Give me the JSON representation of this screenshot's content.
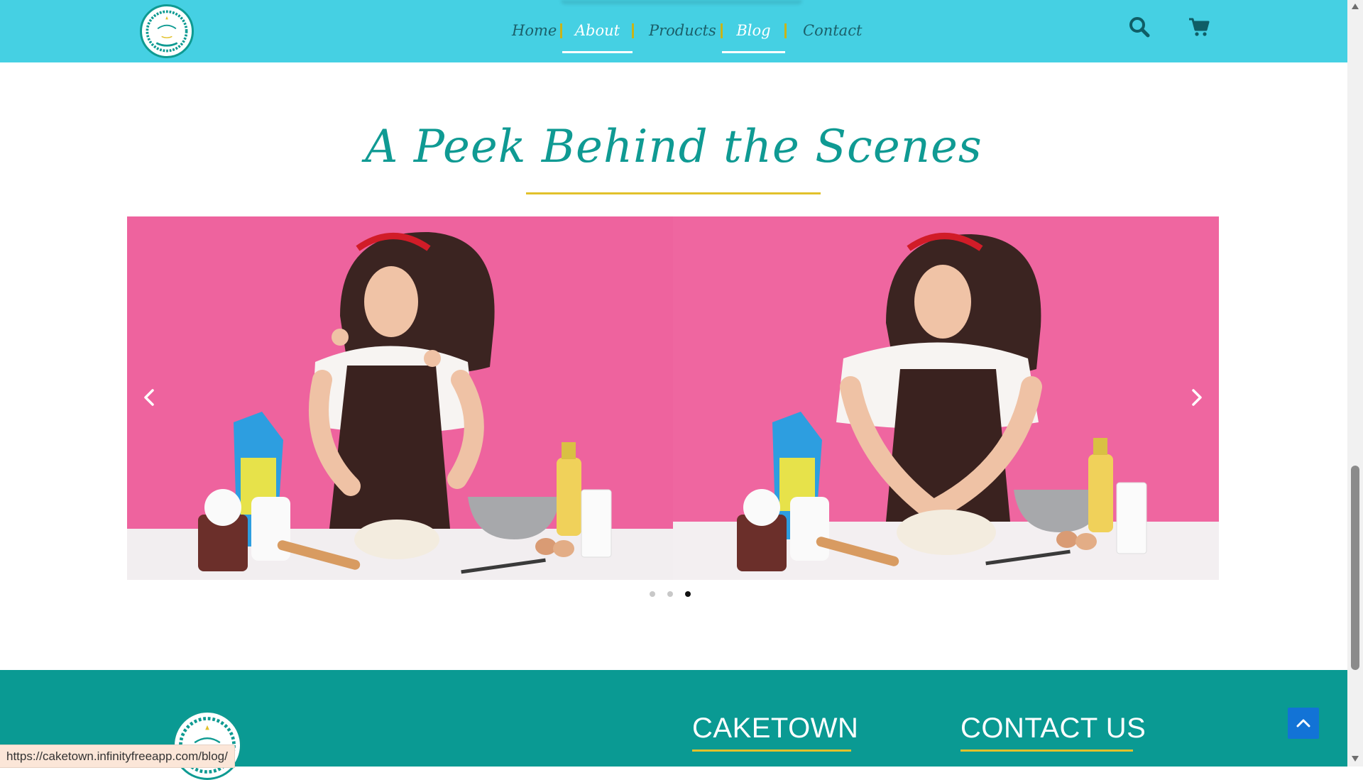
{
  "header": {
    "background": "#45d0e3",
    "nav": [
      {
        "label": "Home",
        "active": false
      },
      {
        "label": "About",
        "active": true
      },
      {
        "label": "Products",
        "active": false
      },
      {
        "label": "Blog",
        "active": true
      },
      {
        "label": "Contact",
        "active": false
      }
    ],
    "icons": [
      "search-icon",
      "cart-icon"
    ]
  },
  "section": {
    "title": "A Peek Behind the Scenes",
    "title_color": "#0f9a93",
    "accent": "#e2c12b",
    "carousel": {
      "slides": [
        "baker-sprinkling-flour-photo",
        "baker-kneading-dough-photo"
      ],
      "dot_count": 3,
      "active_dot": 3
    }
  },
  "footer": {
    "background": "#0a9a93",
    "headings": [
      "CAKETOWN",
      "CONTACT US"
    ]
  },
  "status_bar": {
    "url": "https://caketown.infinityfreeapp.com/blog/"
  }
}
